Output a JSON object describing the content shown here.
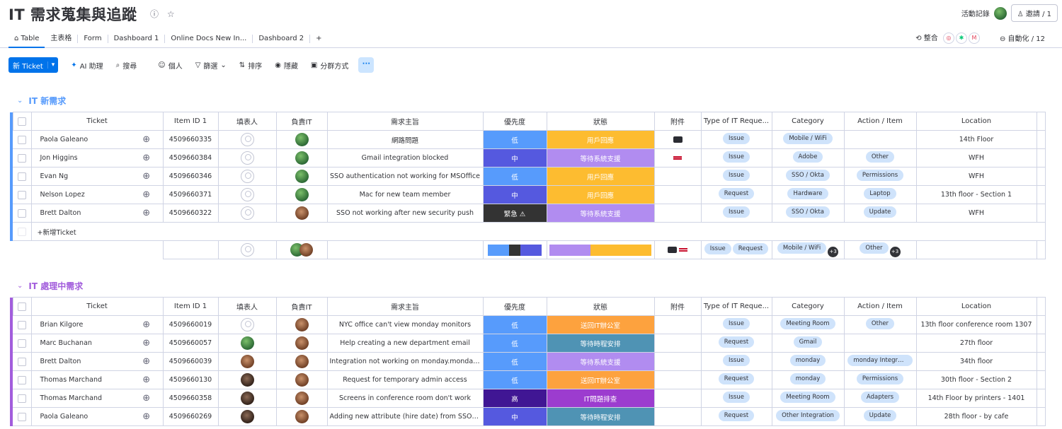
{
  "header": {
    "title": "IT 需求蒐集與追蹤",
    "activity_label": "活動記錄",
    "invite_label": "邀請 / 1"
  },
  "tabs": [
    {
      "label": "Table",
      "active": true
    },
    {
      "label": "主表格"
    },
    {
      "label": "Form"
    },
    {
      "label": "Dashboard 1"
    },
    {
      "label": "Online Docs New In..."
    },
    {
      "label": "Dashboard 2"
    },
    {
      "label": "+"
    }
  ],
  "tabs_right": {
    "integrate_label": "整合",
    "automate_label": "自動化 / 12"
  },
  "toolbar": {
    "new_label": "新 Ticket",
    "ai_label": "AI 助理",
    "search_label": "搜尋",
    "person_label": "個人",
    "filter_label": "篩選",
    "sort_label": "排序",
    "hide_label": "隱藏",
    "group_label": "分群方式",
    "more_label": "···"
  },
  "columns": [
    "Ticket",
    "Item ID 1",
    "填表人",
    "負責IT",
    "需求主旨",
    "優先度",
    "狀態",
    "附件",
    "Type of IT Reque...",
    "Category",
    "Action / Item",
    "Location"
  ],
  "colors": {
    "low": "#579bfc",
    "medium": "#5559df",
    "urgent": "#333333",
    "high": "#401694",
    "user_reply": "#fdbc30",
    "wait_sys": "#a25ddc",
    "wait_sys_light": "#b18cf0",
    "return_office": "#fda23e",
    "wait_schedule": "#4f93b4",
    "it_check": "#9c3ccf",
    "group1": "#579bfc",
    "group2": "#a25ddc"
  },
  "groups": [
    {
      "title": "IT 新需求",
      "color": "#579bfc",
      "rows": [
        {
          "ticket": "Paola Galeano",
          "item_id": "4509660335",
          "filler": "empty",
          "it": "green",
          "subject": "網路問題",
          "priority": "低",
          "pri_color": "#579bfc",
          "status": "用戶回應",
          "sta_color": "#fdbc30",
          "attach": "dark",
          "type": "Issue",
          "category": "Mobile / WiFi",
          "action": "",
          "location": "14th Floor"
        },
        {
          "ticket": "Jon Higgins",
          "item_id": "4509660384",
          "filler": "empty",
          "it": "green",
          "subject": "Gmail integration blocked",
          "priority": "中",
          "pri_color": "#5559df",
          "status": "等待系統支援",
          "sta_color": "#b18cf0",
          "attach": "flag",
          "type": "Issue",
          "category": "Adobe",
          "action": "Other",
          "location": "WFH"
        },
        {
          "ticket": "Evan Ng",
          "item_id": "4509660346",
          "filler": "empty",
          "it": "green",
          "subject": "SSO authentication not working for MSOffice",
          "priority": "低",
          "pri_color": "#579bfc",
          "status": "用戶回應",
          "sta_color": "#fdbc30",
          "attach": "",
          "type": "Issue",
          "category": "SSO / Okta",
          "action": "Permissions",
          "location": "WFH"
        },
        {
          "ticket": "Nelson Lopez",
          "item_id": "4509660371",
          "filler": "empty",
          "it": "green",
          "subject": "Mac for new team member",
          "priority": "中",
          "pri_color": "#5559df",
          "status": "用戶回應",
          "sta_color": "#fdbc30",
          "attach": "",
          "type": "Request",
          "category": "Hardware",
          "action": "Laptop",
          "location": "13th floor - Section 1"
        },
        {
          "ticket": "Brett Dalton",
          "item_id": "4509660322",
          "filler": "empty",
          "it": "brown",
          "subject": "SSO not working after new security push",
          "priority": "緊急 ⚠",
          "pri_color": "#333333",
          "status": "等待系統支援",
          "sta_color": "#b18cf0",
          "attach": "",
          "type": "Issue",
          "category": "SSO / Okta",
          "action": "Update",
          "location": "WFH"
        }
      ],
      "add_label": "+新增Ticket",
      "summary": {
        "type_pills": [
          "Issue",
          "Request"
        ],
        "category_pill": "Mobile / WiFi",
        "category_more": "+3",
        "action_pill": "Other",
        "action_more": "+3",
        "priority_share": [
          0.4,
          0.2,
          0.4
        ],
        "status_share": [
          0.4,
          0.6
        ]
      }
    },
    {
      "title": "IT 處理中需求",
      "color": "#a25ddc",
      "rows": [
        {
          "ticket": "Brian Kilgore",
          "item_id": "4509660019",
          "filler": "empty",
          "it": "brown",
          "subject": "NYC office can't view monday monitors",
          "priority": "低",
          "pri_color": "#579bfc",
          "status": "送回IT辦公室",
          "sta_color": "#fda23e",
          "attach": "",
          "type": "Issue",
          "category": "Meeting Room",
          "action": "Other",
          "location": "13th floor conference room 1307"
        },
        {
          "ticket": "Marc Buchanan",
          "item_id": "4509660057",
          "filler": "green",
          "it": "brown",
          "subject": "Help creating a new department email",
          "priority": "低",
          "pri_color": "#579bfc",
          "status": "等待時程安排",
          "sta_color": "#4f93b4",
          "attach": "",
          "type": "Request",
          "category": "Gmail",
          "action": "",
          "location": "27th floor"
        },
        {
          "ticket": "Brett Dalton",
          "item_id": "4509660039",
          "filler": "brown",
          "it": "brown",
          "subject": "Integration not working on monday.monday ac...",
          "priority": "低",
          "pri_color": "#579bfc",
          "status": "等待系統支援",
          "sta_color": "#b18cf0",
          "attach": "",
          "type": "Issue",
          "category": "monday",
          "action": "monday Integrati...",
          "location": "34th floor"
        },
        {
          "ticket": "Thomas Marchand",
          "item_id": "4509660130",
          "filler": "dark",
          "it": "brown",
          "subject": "Request for temporary admin access",
          "priority": "低",
          "pri_color": "#579bfc",
          "status": "送回IT辦公室",
          "sta_color": "#fda23e",
          "attach": "",
          "type": "Request",
          "category": "monday",
          "action": "Permissions",
          "location": "30th floor - Section 2"
        },
        {
          "ticket": "Thomas Marchand",
          "item_id": "4509660358",
          "filler": "dark",
          "it": "brown",
          "subject": "Screens in conference room don't work",
          "priority": "高",
          "pri_color": "#401694",
          "status": "IT問題排查",
          "sta_color": "#9c3ccf",
          "attach": "",
          "type": "Issue",
          "category": "Meeting Room",
          "action": "Adapters",
          "location": "14th Floor by printers - 1401"
        },
        {
          "ticket": "Paola Galeano",
          "item_id": "4509660269",
          "filler": "dark",
          "it": "brown",
          "subject": "Adding new attribute (hire date) from SSO to L...",
          "priority": "中",
          "pri_color": "#5559df",
          "status": "等待時程安排",
          "sta_color": "#4f93b4",
          "attach": "",
          "type": "Request",
          "category": "Other Integration",
          "action": "Update",
          "location": "28th floor - by cafe"
        }
      ]
    }
  ]
}
